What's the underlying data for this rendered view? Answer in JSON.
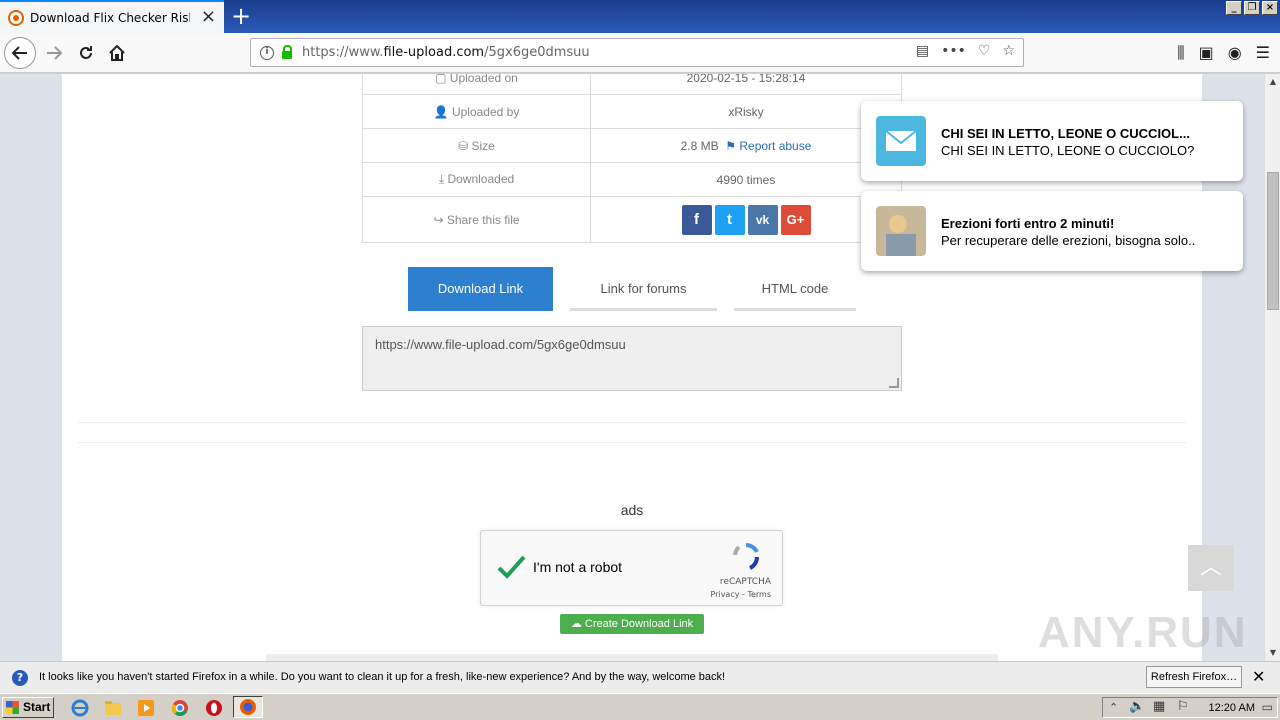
{
  "browser": {
    "tab_title": "Download Flix Checker Risky rar",
    "new_tab": "+",
    "url_scheme": "https://www.",
    "url_domain": "file-upload.com",
    "url_path": "/5gx6ge0dmsuu"
  },
  "file_info": {
    "uploaded_on_label": "Uploaded on",
    "uploaded_on_value": "2020-02-15 - 15:28:14",
    "uploaded_by_label": "Uploaded by",
    "uploaded_by_value": "xRisky",
    "size_label": "Size",
    "size_value": "2.8 MB",
    "report_abuse": "Report abuse",
    "downloaded_label": "Downloaded",
    "downloaded_value": "4990 times",
    "share_label": "Share this file",
    "social": [
      "f",
      "t",
      "vk",
      "G+"
    ]
  },
  "link_tabs": {
    "download": "Download Link",
    "forums": "Link for forums",
    "html": "HTML code"
  },
  "link_box": "https://www.file-upload.com/5gx6ge0dmsuu",
  "ads_label": "ads",
  "captcha": {
    "label": "I'm not a robot",
    "brand": "reCAPTCHA",
    "terms": "Privacy - Terms"
  },
  "create_link": "Create Download Link",
  "notifications": [
    {
      "title": "CHI SEI IN LETTO, LEONE O CUCCIOL...",
      "body": "CHI SEI IN LETTO, LEONE O CUCCIOLO?"
    },
    {
      "title": "Erezioni forti entro 2 minuti!",
      "body": "Per recuperare delle erezioni, bisogna solo.."
    }
  ],
  "ff_bar": {
    "message": "It looks like you haven't started Firefox in a while. Do you want to clean it up for a fresh, like-new experience? And by the way, welcome back!",
    "refresh_button": "Refresh Firefox…"
  },
  "watermark": "ANY.RUN",
  "taskbar": {
    "start": "Start",
    "clock": "12:20 AM"
  },
  "colors": {
    "accent": "#2d7fd0",
    "link": "#2a6fb8",
    "create_button": "#4cae4c",
    "facebook": "#3b5998",
    "twitter": "#1da1f2",
    "vk": "#4a76a8",
    "gplus": "#dd4b39"
  }
}
